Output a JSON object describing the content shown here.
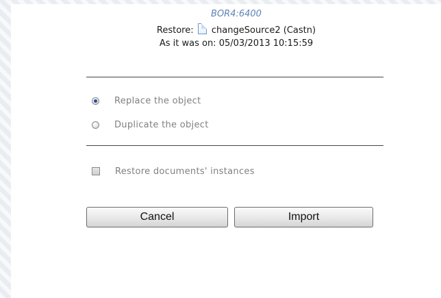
{
  "header": {
    "object_id": "BOR4:6400",
    "restore_label": "Restore:",
    "object_name": "changeSource2 (Castn)",
    "as_of_text": "As it was on: 05/03/2013 10:15:59"
  },
  "options": {
    "replace_label": "Replace the object",
    "duplicate_label": "Duplicate the object",
    "selected": "replace"
  },
  "restore_instances": {
    "label": "Restore documents' instances",
    "checked": false
  },
  "buttons": {
    "cancel_label": "Cancel",
    "import_label": "Import"
  },
  "colors": {
    "object_id": "#5b84b5",
    "option_text": "#808080",
    "radio_selected": "#1f4f9e"
  },
  "icons": {
    "object_icon": "document-icon"
  }
}
